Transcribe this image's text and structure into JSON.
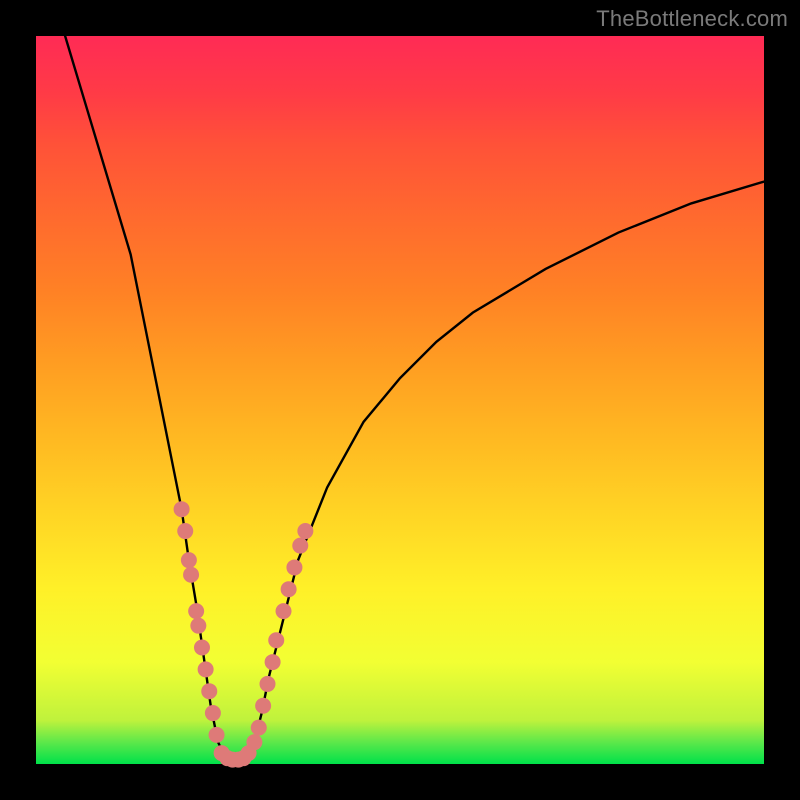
{
  "watermark": "TheBottleneck.com",
  "colors": {
    "background": "#000000",
    "watermark_text": "#7a7a7a",
    "curve_stroke": "#000000",
    "marker_fill": "#de7a78",
    "gradient_stops": [
      "#00e14a",
      "#5de84a",
      "#bff23c",
      "#f2ff33",
      "#fff028",
      "#ffd324",
      "#ffb822",
      "#ff9d22",
      "#ff8125",
      "#ff6a2e",
      "#ff5238",
      "#ff3b46",
      "#ff2b55"
    ]
  },
  "chart_data": {
    "type": "line",
    "title": "",
    "xlabel": "",
    "ylabel": "",
    "xlim": [
      0,
      100
    ],
    "ylim": [
      0,
      100
    ],
    "grid": false,
    "notes": "V-shaped curve. Left branch steep/near-vertical descending from top-left to a flat minimum near x≈27, right branch concave ascending toward the upper-right. Markers clustered on both branches in the lower ~35% of the plot.",
    "series": [
      {
        "name": "curve",
        "style": "line",
        "points": [
          {
            "x": 4,
            "y": 100
          },
          {
            "x": 7,
            "y": 90
          },
          {
            "x": 10,
            "y": 80
          },
          {
            "x": 13,
            "y": 70
          },
          {
            "x": 15,
            "y": 60
          },
          {
            "x": 17,
            "y": 50
          },
          {
            "x": 19,
            "y": 40
          },
          {
            "x": 20,
            "y": 35
          },
          {
            "x": 21,
            "y": 28
          },
          {
            "x": 22,
            "y": 22
          },
          {
            "x": 23,
            "y": 15
          },
          {
            "x": 24,
            "y": 8
          },
          {
            "x": 25,
            "y": 3
          },
          {
            "x": 26,
            "y": 1
          },
          {
            "x": 27,
            "y": 0.5
          },
          {
            "x": 28,
            "y": 0.5
          },
          {
            "x": 29,
            "y": 1
          },
          {
            "x": 30,
            "y": 3
          },
          {
            "x": 31,
            "y": 7
          },
          {
            "x": 32,
            "y": 12
          },
          {
            "x": 34,
            "y": 20
          },
          {
            "x": 36,
            "y": 28
          },
          {
            "x": 40,
            "y": 38
          },
          {
            "x": 45,
            "y": 47
          },
          {
            "x": 50,
            "y": 53
          },
          {
            "x": 55,
            "y": 58
          },
          {
            "x": 60,
            "y": 62
          },
          {
            "x": 70,
            "y": 68
          },
          {
            "x": 80,
            "y": 73
          },
          {
            "x": 90,
            "y": 77
          },
          {
            "x": 100,
            "y": 80
          }
        ]
      },
      {
        "name": "markers",
        "style": "scatter",
        "points": [
          {
            "x": 20.0,
            "y": 35
          },
          {
            "x": 20.5,
            "y": 32
          },
          {
            "x": 21.0,
            "y": 28
          },
          {
            "x": 21.3,
            "y": 26
          },
          {
            "x": 22.0,
            "y": 21
          },
          {
            "x": 22.3,
            "y": 19
          },
          {
            "x": 22.8,
            "y": 16
          },
          {
            "x": 23.3,
            "y": 13
          },
          {
            "x": 23.8,
            "y": 10
          },
          {
            "x": 24.3,
            "y": 7
          },
          {
            "x": 24.8,
            "y": 4
          },
          {
            "x": 25.5,
            "y": 1.5
          },
          {
            "x": 26.3,
            "y": 0.8
          },
          {
            "x": 27.0,
            "y": 0.6
          },
          {
            "x": 27.8,
            "y": 0.6
          },
          {
            "x": 28.5,
            "y": 0.8
          },
          {
            "x": 29.2,
            "y": 1.5
          },
          {
            "x": 30.0,
            "y": 3
          },
          {
            "x": 30.6,
            "y": 5
          },
          {
            "x": 31.2,
            "y": 8
          },
          {
            "x": 31.8,
            "y": 11
          },
          {
            "x": 32.5,
            "y": 14
          },
          {
            "x": 33.0,
            "y": 17
          },
          {
            "x": 34.0,
            "y": 21
          },
          {
            "x": 34.7,
            "y": 24
          },
          {
            "x": 35.5,
            "y": 27
          },
          {
            "x": 36.3,
            "y": 30
          },
          {
            "x": 37.0,
            "y": 32
          }
        ]
      }
    ]
  }
}
